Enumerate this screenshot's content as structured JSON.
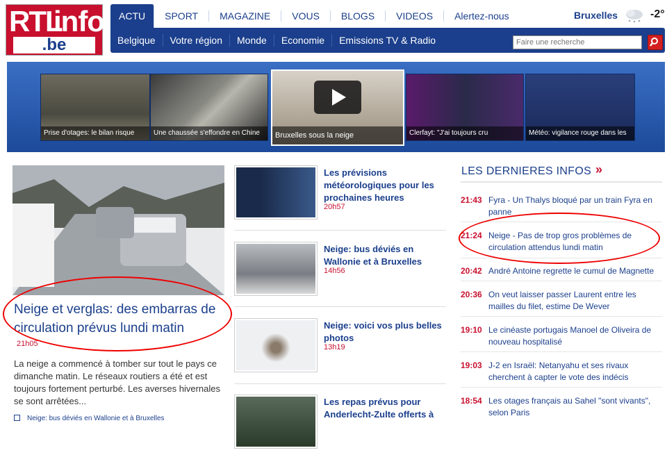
{
  "logo": {
    "rtl": "RTL",
    "info": "info",
    "be": ".be"
  },
  "nav_main": [
    "ACTU",
    "SPORT",
    "MAGAZINE",
    "VOUS",
    "BLOGS",
    "VIDEOS",
    "Alertez-nous"
  ],
  "nav_active": "ACTU",
  "weather": {
    "city": "Bruxelles",
    "temp": "-2°",
    "icon": "snow-cloud-icon"
  },
  "nav_sub": [
    "Belgique",
    "Votre région",
    "Monde",
    "Economie",
    "Emissions TV & Radio"
  ],
  "search": {
    "placeholder": "Faire une recherche",
    "icon": "search-icon"
  },
  "carousel": [
    {
      "caption": "Prise d'otages: le bilan risque"
    },
    {
      "caption": "Une chaussée s'effondre en Chine"
    },
    {
      "caption": "Bruxelles sous la neige"
    },
    {
      "caption": "Clerfayt: \"J'ai toujours cru"
    },
    {
      "caption": "Météo: vigilance rouge dans les"
    }
  ],
  "main_story": {
    "headline": "Neige et verglas: des embarras de circulation prévus lundi matin",
    "time": "21h05",
    "summary": "La neige a commencé à tomber sur tout le pays ce dimanche matin. Le réseaux routiers a été et est toujours fortement perturbé. Les averses hivernales se sont arrêtées...",
    "related": "Neige: bus déviés en Wallonie et à Bruxelles"
  },
  "mid_stories": [
    {
      "title": "Les prévisions météorologiques pour les prochaines heures",
      "time": "20h57"
    },
    {
      "title": "Neige: bus déviés en Wallonie et à Bruxelles",
      "time": "14h56"
    },
    {
      "title": "Neige: voici vos plus belles photos",
      "time": "13h19"
    },
    {
      "title": "Les repas prévus pour Anderlecht-Zulte offerts à",
      "time": ""
    }
  ],
  "latest": {
    "heading": "LES DERNIERES INFOS",
    "arrow": "»",
    "items": [
      {
        "time": "21:43",
        "text": "Fyra - Un Thalys bloqué par un train Fyra en panne"
      },
      {
        "time": "21:24",
        "text": "Neige - Pas de trop gros problèmes de circulation attendus lundi matin"
      },
      {
        "time": "20:42",
        "text": "André Antoine regrette le cumul de Magnette"
      },
      {
        "time": "20:36",
        "text": "On veut laisser passer Laurent entre les mailles du filet, estime De Wever"
      },
      {
        "time": "19:10",
        "text": "Le cinéaste portugais Manoel de Oliveira de nouveau hospitalisé"
      },
      {
        "time": "19:03",
        "text": "J-2 en Israël: Netanyahu et ses rivaux cherchent à capter le vote des indécis"
      },
      {
        "time": "18:54",
        "text": "Les otages français au Sahel \"sont vivants\", selon Paris"
      }
    ]
  }
}
